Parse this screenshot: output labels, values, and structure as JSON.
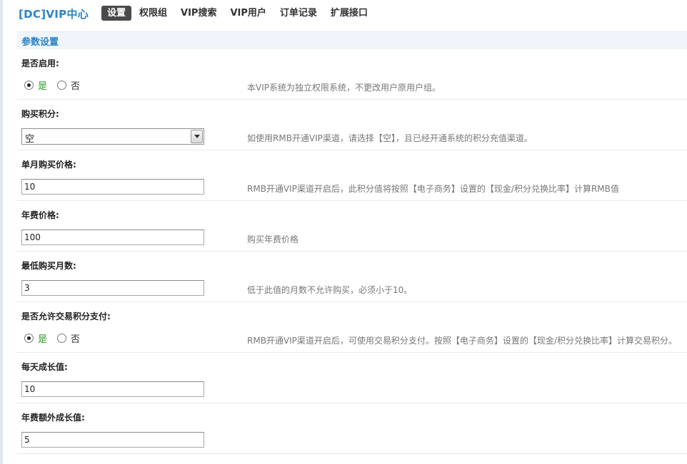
{
  "header": {
    "brand": "[DC]VIP中心",
    "nav": [
      {
        "label": "设置",
        "active": true
      },
      {
        "label": "权限组",
        "active": false
      },
      {
        "label": "VIP搜索",
        "active": false
      },
      {
        "label": "VIP用户",
        "active": false
      },
      {
        "label": "订单记录",
        "active": false
      },
      {
        "label": "扩展接口",
        "active": false
      }
    ]
  },
  "section": {
    "title": "参数设置"
  },
  "fields": {
    "enable": {
      "label": "是否启用:",
      "yes": "是",
      "no": "否",
      "selected": "yes",
      "tip": "本VIP系统为独立权限系统，不更改用户原用户组。"
    },
    "buy_credit": {
      "label": "购买积分:",
      "value": "空",
      "tip": "如使用RMB开通VIP渠道，请选择【空】，且已经开通系统的积分充值渠道。"
    },
    "monthly_price": {
      "label": "单月购买价格:",
      "value": "10",
      "tip": "RMB开通VIP渠道开启后，此积分值将按照【电子商务】设置的【现金/积分兑换比率】计算RMB值"
    },
    "annual_price": {
      "label": "年费价格:",
      "value": "100",
      "tip": "购买年费价格"
    },
    "min_months": {
      "label": "最低购买月数:",
      "value": "3",
      "tip": "低于此值的月数不允许购买，必须小于10。"
    },
    "allow_trade_credit": {
      "label": "是否允许交易积分支付:",
      "yes": "是",
      "no": "否",
      "selected": "yes",
      "tip": "RMB开通VIP渠道开启后，可使用交易积分支付。按照【电子商务】设置的【现金/积分兑换比率】计算交易积分。"
    },
    "daily_growth": {
      "label": "每天成长值:",
      "value": "10"
    },
    "annual_extra_growth": {
      "label": "年费额外成长值:",
      "value": "5"
    }
  }
}
